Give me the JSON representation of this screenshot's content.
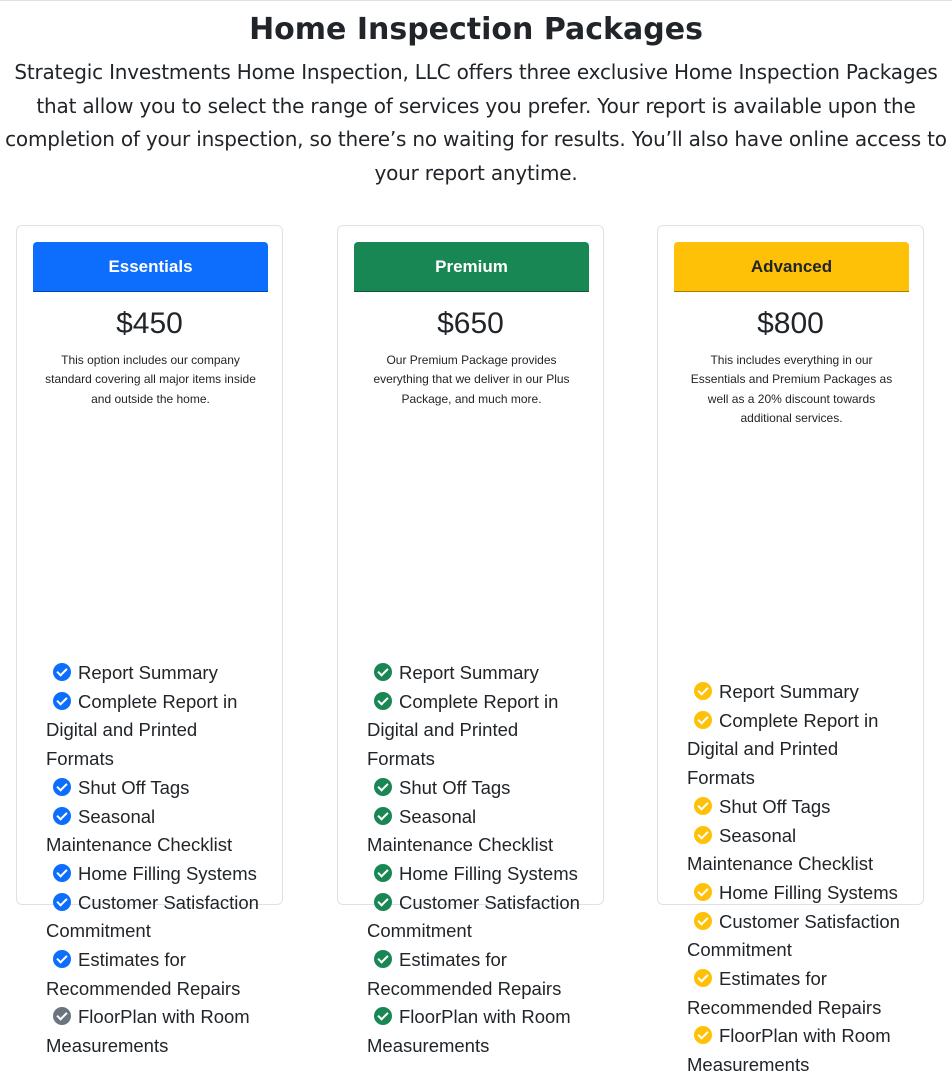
{
  "header": {
    "title": "Home Inspection Packages",
    "intro": "Strategic Investments Home Inspection, LLC offers three exclusive Home Inspection Packages that allow you to select the range of services you prefer. Your report is available upon the completion of your inspection, so there’s no waiting for results. You’ll also have online access to your report anytime."
  },
  "packages": [
    {
      "name": "Essentials",
      "price": "$450",
      "description": "This option includes our company standard covering all major items inside and outside the home.",
      "header_color": "#0d6efd",
      "header_text_color": "#ffffff",
      "check_color": "#0d6efd",
      "features": [
        {
          "label": "Report Summary",
          "check_color": "#0d6efd"
        },
        {
          "label": "Complete Report in Digital and Printed Formats",
          "check_color": "#0d6efd"
        },
        {
          "label": "Shut Off Tags",
          "check_color": "#0d6efd"
        },
        {
          "label": "Seasonal Maintenance Checklist",
          "check_color": "#0d6efd"
        },
        {
          "label": "Home Filling Systems",
          "check_color": "#0d6efd"
        },
        {
          "label": "Customer Satisfaction Commitment",
          "check_color": "#0d6efd"
        },
        {
          "label": "Estimates for Recommended Repairs",
          "check_color": "#0d6efd"
        },
        {
          "label": "FloorPlan with Room Measurements",
          "check_color": "#6c757d"
        }
      ]
    },
    {
      "name": "Premium",
      "price": "$650",
      "description": "Our Premium Package provides everything that we deliver in our Plus Package, and much more.",
      "header_color": "#198754",
      "header_text_color": "#ffffff",
      "check_color": "#198754",
      "features": [
        {
          "label": "Report Summary",
          "check_color": "#198754"
        },
        {
          "label": "Complete Report in Digital and Printed Formats",
          "check_color": "#198754"
        },
        {
          "label": "Shut Off Tags",
          "check_color": "#198754"
        },
        {
          "label": "Seasonal Maintenance Checklist",
          "check_color": "#198754"
        },
        {
          "label": "Home Filling Systems",
          "check_color": "#198754"
        },
        {
          "label": "Customer Satisfaction Commitment",
          "check_color": "#198754"
        },
        {
          "label": "Estimates for Recommended Repairs",
          "check_color": "#198754"
        },
        {
          "label": "FloorPlan with Room Measurements",
          "check_color": "#198754"
        }
      ]
    },
    {
      "name": "Advanced",
      "price": "$800",
      "description": "This includes everything in our Essentials and Premium Packages as well as a 20% discount towards additional services.",
      "header_color": "#ffc107",
      "header_text_color": "#212529",
      "check_color": "#ffc107",
      "features": [
        {
          "label": "Report Summary",
          "check_color": "#ffc107"
        },
        {
          "label": "Complete Report in Digital and Printed Formats",
          "check_color": "#ffc107"
        },
        {
          "label": "Shut Off Tags",
          "check_color": "#ffc107"
        },
        {
          "label": "Seasonal Maintenance Checklist",
          "check_color": "#ffc107"
        },
        {
          "label": "Home Filling Systems",
          "check_color": "#ffc107"
        },
        {
          "label": "Customer Satisfaction Commitment",
          "check_color": "#ffc107"
        },
        {
          "label": "Estimates for Recommended Repairs",
          "check_color": "#ffc107"
        },
        {
          "label": "FloorPlan with Room Measurements",
          "check_color": "#ffc107"
        }
      ]
    }
  ]
}
